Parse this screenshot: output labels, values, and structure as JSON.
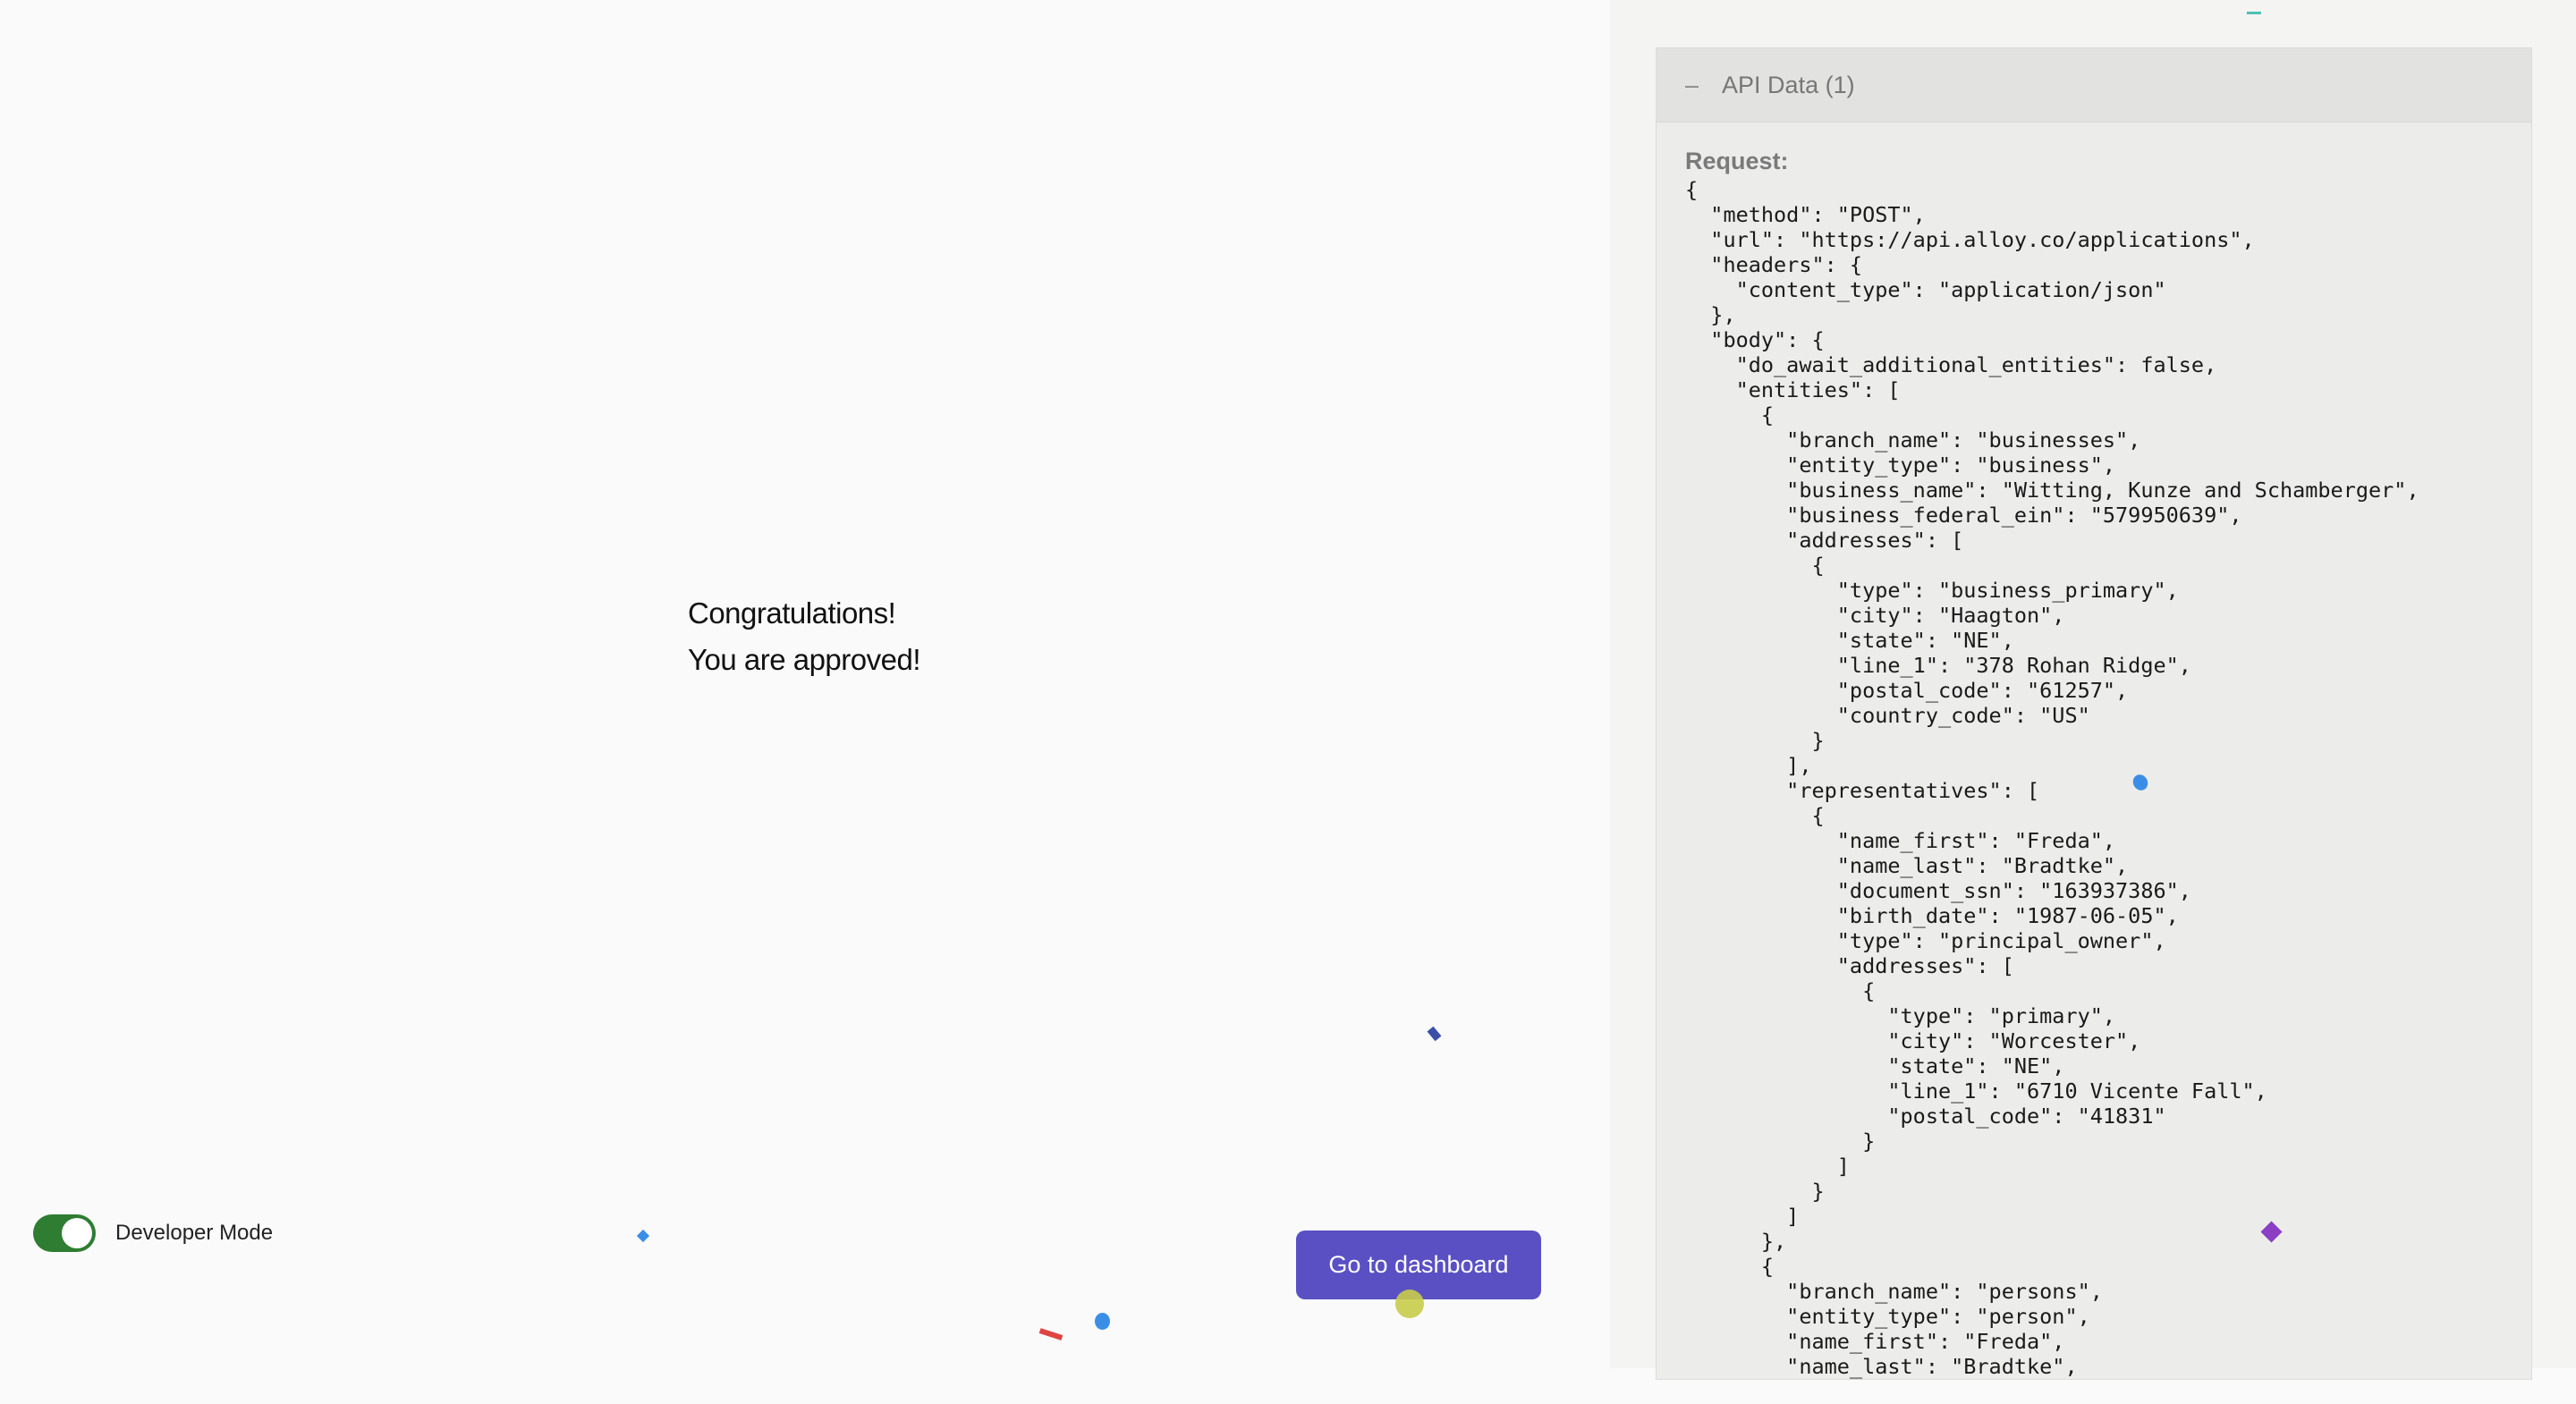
{
  "congrats": {
    "line1": "Congratulations!",
    "line2": "You are approved!"
  },
  "developer_mode": {
    "label": "Developer Mode",
    "enabled": true
  },
  "dashboard_button": {
    "label": "Go to dashboard"
  },
  "api_panel": {
    "collapse_symbol": "–",
    "title": "API Data (1)",
    "request_label": "Request:",
    "request_json": "{\n  \"method\": \"POST\",\n  \"url\": \"https://api.alloy.co/applications\",\n  \"headers\": {\n    \"content_type\": \"application/json\"\n  },\n  \"body\": {\n    \"do_await_additional_entities\": false,\n    \"entities\": [\n      {\n        \"branch_name\": \"businesses\",\n        \"entity_type\": \"business\",\n        \"business_name\": \"Witting, Kunze and Schamberger\",\n        \"business_federal_ein\": \"579950639\",\n        \"addresses\": [\n          {\n            \"type\": \"business_primary\",\n            \"city\": \"Haagton\",\n            \"state\": \"NE\",\n            \"line_1\": \"378 Rohan Ridge\",\n            \"postal_code\": \"61257\",\n            \"country_code\": \"US\"\n          }\n        ],\n        \"representatives\": [\n          {\n            \"name_first\": \"Freda\",\n            \"name_last\": \"Bradtke\",\n            \"document_ssn\": \"163937386\",\n            \"birth_date\": \"1987-06-05\",\n            \"type\": \"principal_owner\",\n            \"addresses\": [\n              {\n                \"type\": \"primary\",\n                \"city\": \"Worcester\",\n                \"state\": \"NE\",\n                \"line_1\": \"6710 Vicente Fall\",\n                \"postal_code\": \"41831\"\n              }\n            ]\n          }\n        ]\n      },\n      {\n        \"branch_name\": \"persons\",\n        \"entity_type\": \"person\",\n        \"name_first\": \"Freda\",\n        \"name_last\": \"Bradtke\","
  },
  "colors": {
    "toggle_on": "#2e7d32",
    "button_bg": "#5a50c4",
    "confetti_blue": "#3a8ee6",
    "confetti_red": "#e04343",
    "confetti_purple": "#8a3fc4",
    "confetti_navy": "#3b4fa8",
    "confetti_teal": "#4fbfb0"
  }
}
